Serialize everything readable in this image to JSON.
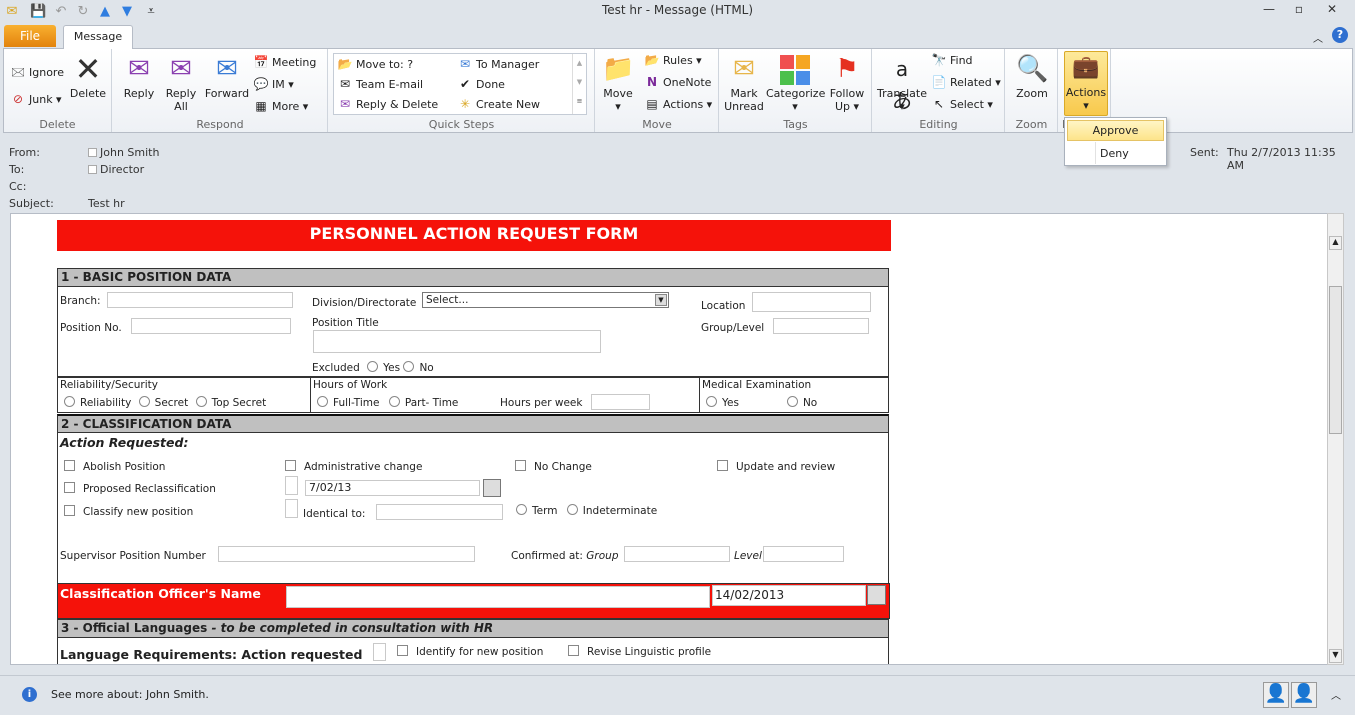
{
  "window": {
    "title": "Test hr - Message (HTML)"
  },
  "tabs": {
    "file": "File",
    "message": "Message"
  },
  "ribbon": {
    "delete": {
      "label": "Delete",
      "ignore": "Ignore",
      "junk": "Junk",
      "delete": "Delete"
    },
    "respond": {
      "label": "Respond",
      "reply": "Reply",
      "reply_all_1": "Reply",
      "reply_all_2": "All",
      "forward": "Forward",
      "meeting": "Meeting",
      "im": "IM",
      "more": "More"
    },
    "quick_steps": {
      "label": "Quick Steps",
      "items": [
        "Move to: ?",
        "Team E-mail",
        "Reply & Delete",
        "To Manager",
        "Done",
        "Create New"
      ]
    },
    "move": {
      "label": "Move",
      "move": "Move",
      "rules": "Rules",
      "onenote": "OneNote",
      "actions": "Actions"
    },
    "tags": {
      "label": "Tags",
      "mark_unread_1": "Mark",
      "mark_unread_2": "Unread",
      "categorize": "Categorize",
      "follow_up_1": "Follow",
      "follow_up_2": "Up"
    },
    "editing": {
      "label": "Editing",
      "translate": "Translate",
      "find": "Find",
      "related": "Related",
      "select": "Select"
    },
    "zoom": {
      "label": "Zoom",
      "zoom": "Zoom"
    },
    "actions_group": {
      "label": "F",
      "actions": "Actions"
    }
  },
  "actions_menu": {
    "approve": "Approve",
    "deny": "Deny"
  },
  "header": {
    "from_label": "From:",
    "from": "John Smith",
    "to_label": "To:",
    "to": "Director",
    "cc_label": "Cc:",
    "subject_label": "Subject:",
    "subject": "Test hr",
    "sent_label": "Sent:",
    "sent": "Thu 2/7/2013 11:35 AM"
  },
  "form": {
    "title": "PERSONNEL ACTION REQUEST FORM",
    "s1": "1 - BASIC POSITION DATA",
    "branch": "Branch:",
    "division": "Division/Directorate",
    "division_value": "Select...",
    "location": "Location",
    "position_no": "Position No.",
    "position_title": "Position Title",
    "group_level": "Group/Level",
    "excluded": "Excluded",
    "yes": "Yes",
    "no": "No",
    "reliability_security": "Reliability/Security",
    "reliability": "Reliability",
    "secret": "Secret",
    "top_secret": "Top Secret",
    "hours_of_work": "Hours of Work",
    "full_time": "Full-Time",
    "part_time": "Part- Time",
    "hours_per_week": "Hours per week",
    "medical": "Medical Examination",
    "s2": "2 - CLASSIFICATION DATA",
    "action_requested": "Action Requested:",
    "abolish": "Abolish Position",
    "admin_change": "Administrative change",
    "no_change": "No Change",
    "update_review": "Update and review",
    "proposed_reclass": "Proposed Reclassification",
    "date1": "7/02/13",
    "classify_new": "Classify new position",
    "identical_to": "Identical to:",
    "term": "Term",
    "indeterminate": "Indeterminate",
    "supervisor_pos": "Supervisor Position Number",
    "confirmed_at": "Confirmed at:",
    "group": "Group",
    "level": "Level",
    "officer_name": "Classification Officer's Name",
    "date2": "14/02/2013",
    "s3_main": "3 - Official Languages",
    "s3_italic": " - to be completed in consultation with HR",
    "lang_req": "Language Requirements: Action requested",
    "identify_new": "Identify for new position",
    "revise_profile": "Revise Linguistic profile"
  },
  "status": {
    "text": "See more about: John Smith."
  },
  "colors": {
    "red": "#f5120a",
    "section_gray": "#c0c0c0",
    "file_tab": "#e9921b"
  }
}
